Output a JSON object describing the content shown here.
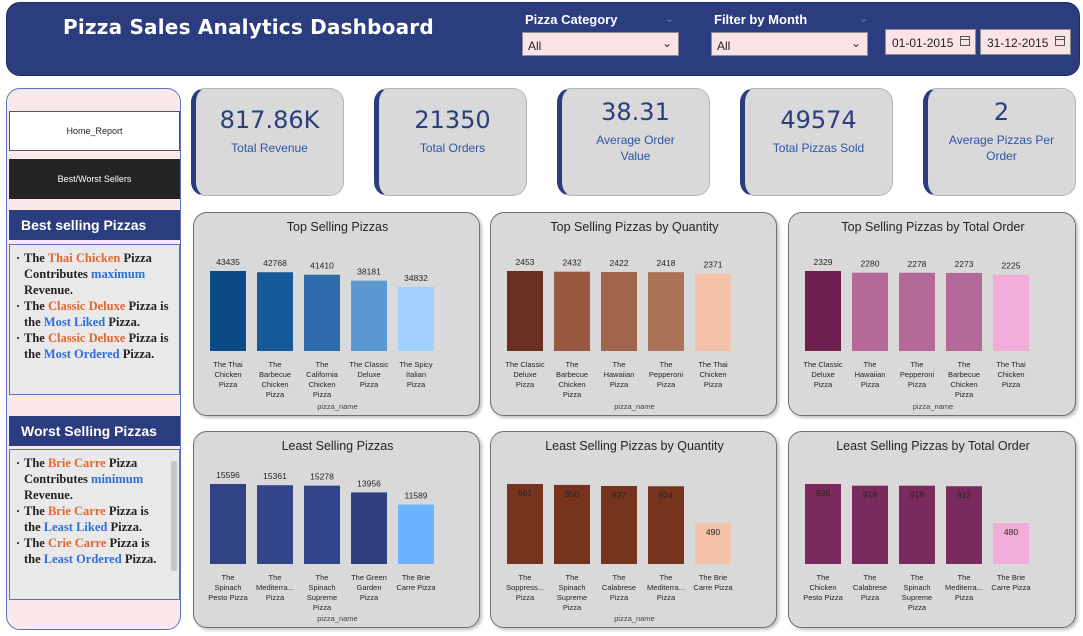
{
  "header": {
    "title": "Pizza Sales Analytics Dashboard",
    "category_filter": {
      "label": "Pizza Category",
      "value": "All"
    },
    "month_filter": {
      "label": "Filter by Month",
      "value": "All"
    },
    "date_from": "01-01-2015",
    "date_to": "31-12-2015"
  },
  "nav": {
    "home": "Home_Report",
    "best_worst": "Best/Worst Sellers"
  },
  "best_section": {
    "title": "Best selling Pizzas",
    "lines": [
      [
        [
          "",
          "The "
        ],
        [
          "o",
          "Thai Chicken"
        ],
        [
          "",
          " Pizza Contributes "
        ],
        [
          "b",
          "maximum"
        ],
        [
          "",
          " Revenue."
        ]
      ],
      [
        [
          "",
          "The "
        ],
        [
          "o",
          "Classic Deluxe"
        ],
        [
          "",
          " Pizza is the "
        ],
        [
          "b",
          "Most Liked"
        ],
        [
          "",
          " Pizza."
        ]
      ],
      [
        [
          "",
          "The "
        ],
        [
          "o",
          "Classic Deluxe"
        ],
        [
          "",
          " Pizza is the "
        ],
        [
          "b",
          "Most Ordered"
        ],
        [
          "",
          " Pizza."
        ]
      ]
    ]
  },
  "worst_section": {
    "title": "Worst Selling Pizzas",
    "lines": [
      [
        [
          "",
          "The "
        ],
        [
          "o",
          "Brie Carre"
        ],
        [
          "",
          " Pizza Contributes "
        ],
        [
          "b",
          "minimum"
        ],
        [
          "",
          " Revenue."
        ]
      ],
      [
        [
          "",
          "The "
        ],
        [
          "o",
          "Brie Carre"
        ],
        [
          "",
          " Pizza is the "
        ],
        [
          "b",
          "Least Liked"
        ],
        [
          "",
          " Pizza."
        ]
      ],
      [
        [
          "",
          "The "
        ],
        [
          "o",
          "Crie Carre"
        ],
        [
          "",
          " Pizza is the "
        ],
        [
          "b",
          "Least Ordered"
        ],
        [
          "",
          " Pizza."
        ]
      ]
    ]
  },
  "kpis": [
    {
      "value": "817.86K",
      "label": "Total Revenue"
    },
    {
      "value": "21350",
      "label": "Total Orders"
    },
    {
      "value": "38.31",
      "label": "Average Order Value"
    },
    {
      "value": "49574",
      "label": "Total Pizzas Sold"
    },
    {
      "value": "2",
      "label": "Average Pizzas Per Order"
    }
  ],
  "chart_data": [
    {
      "type": "bar",
      "title": "Top Selling Pizzas",
      "xlabel": "pizza_name",
      "categories": [
        [
          "The Thai",
          "Chicken",
          "Pizza"
        ],
        [
          "The",
          "Barbecue",
          "Chicken",
          "Pizza"
        ],
        [
          "The",
          "California",
          "Chicken",
          "Pizza"
        ],
        [
          "The Classic",
          "Deluxe",
          "Pizza"
        ],
        [
          "The Spicy",
          "Italian",
          "Pizza"
        ]
      ],
      "values": [
        43435,
        42768,
        41410,
        38181,
        34832
      ],
      "labels": [
        "43435",
        "42768",
        "41410",
        "38181",
        "34832"
      ],
      "colors": [
        "#0b4a86",
        "#175a98",
        "#2d6aaa",
        "#5b99d3",
        "#9fd0ff"
      ],
      "label_inside": false
    },
    {
      "type": "bar",
      "title": "Top Selling Pizzas by Quantity",
      "xlabel": "pizza_name",
      "categories": [
        [
          "The Classic",
          "Deluxe",
          "Pizza"
        ],
        [
          "The",
          "Barbecue",
          "Chicken",
          "Pizza"
        ],
        [
          "The",
          "Hawaiian",
          "Pizza"
        ],
        [
          "The",
          "Pepperoni",
          "Pizza"
        ],
        [
          "The Thai",
          "Chicken",
          "Pizza"
        ]
      ],
      "values": [
        2453,
        2432,
        2422,
        2418,
        2371
      ],
      "labels": [
        "2453",
        "2432",
        "2422",
        "2418",
        "2371"
      ],
      "colors": [
        "#6b2f1f",
        "#97583f",
        "#a0654c",
        "#ad7358",
        "#f3c2a8"
      ],
      "label_inside": false
    },
    {
      "type": "bar",
      "title": "Top Selling Pizzas by Total Order",
      "xlabel": "pizza_name",
      "categories": [
        [
          "The Classic",
          "Deluxe",
          "Pizza"
        ],
        [
          "The",
          "Hawaiian",
          "Pizza"
        ],
        [
          "The",
          "Pepperoni",
          "Pizza"
        ],
        [
          "The",
          "Barbecue",
          "Chicken",
          "Pizza"
        ],
        [
          "The Thai",
          "Chicken",
          "Pizza"
        ]
      ],
      "values": [
        2329,
        2280,
        2278,
        2273,
        2225
      ],
      "labels": [
        "2329",
        "2280",
        "2278",
        "2273",
        "2225"
      ],
      "colors": [
        "#6d1f4e",
        "#b46a99",
        "#b46a99",
        "#b46a99",
        "#f2acd8"
      ],
      "label_inside": false
    },
    {
      "type": "bar",
      "title": "Least Selling Pizzas",
      "xlabel": "pizza_name",
      "categories": [
        [
          "The",
          "Spinach",
          "Pesto Pizza"
        ],
        [
          "The",
          "Mediterra...",
          "Pizza"
        ],
        [
          "The",
          "Spinach",
          "Supreme",
          "Pizza"
        ],
        [
          "The Green",
          "Garden",
          "Pizza"
        ],
        [
          "The Brie",
          "Carre Pizza"
        ]
      ],
      "values": [
        15596,
        15361,
        15278,
        13956,
        11589
      ],
      "labels": [
        "15596",
        "15361",
        "15278",
        "13956",
        "11589"
      ],
      "colors": [
        "#324385",
        "#34468a",
        "#33458a",
        "#2f3e7f",
        "#6bb2ff"
      ],
      "label_inside": false
    },
    {
      "type": "bar",
      "title": "Least Selling Pizzas by Quantity",
      "xlabel": "pizza_name",
      "categories": [
        [
          "The",
          "Soppress...",
          "Pizza"
        ],
        [
          "The",
          "Spinach",
          "Supreme",
          "Pizza"
        ],
        [
          "The",
          "Calabrese",
          "Pizza"
        ],
        [
          "The",
          "Mediterra...",
          "Pizza"
        ],
        [
          "The Brie",
          "Carre Pizza"
        ]
      ],
      "values": [
        961,
        950,
        937,
        934,
        490
      ],
      "labels": [
        "961",
        "950",
        "937",
        "934",
        "490"
      ],
      "colors": [
        "#76341f",
        "#76341f",
        "#76341f",
        "#76341f",
        "#f3c2a8"
      ],
      "label_inside": true
    },
    {
      "type": "bar",
      "title": "Least Selling Pizzas by Total Order",
      "xlabel": "",
      "categories": [
        [
          "The",
          "Chicken",
          "Pesto Pizza"
        ],
        [
          "The",
          "Calabrese",
          "Pizza"
        ],
        [
          "The",
          "Spinach",
          "Supreme",
          "Pizza"
        ],
        [
          "The",
          "Mediterra...",
          "Pizza"
        ],
        [
          "The Brie",
          "Carre Pizza"
        ]
      ],
      "values": [
        938,
        918,
        918,
        912,
        480
      ],
      "labels": [
        "938",
        "918",
        "918",
        "912",
        "480"
      ],
      "colors": [
        "#7a2a5c",
        "#7a2a5c",
        "#7a2a5c",
        "#7a2a5c",
        "#f2acd8"
      ],
      "label_inside": true
    }
  ]
}
